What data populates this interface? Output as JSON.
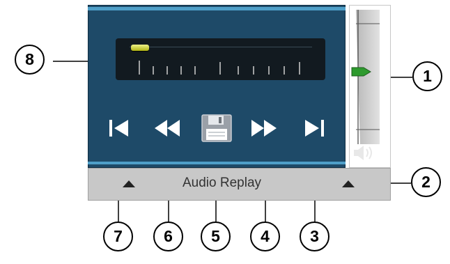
{
  "panel": {
    "title": "Audio Replay",
    "seek_position": 0.0,
    "volume_level": 0.55,
    "colors": {
      "panel_bg": "#1e4a68",
      "accent_line": "#4f9fc8",
      "thumb": "#d6db33",
      "volume_thumb": "#2e9a2e",
      "bar_bg": "#c8c8c8"
    }
  },
  "controls": [
    {
      "name": "skip-to-start-button",
      "icon": "skip-back-icon"
    },
    {
      "name": "rewind-button",
      "icon": "rewind-icon"
    },
    {
      "name": "save-button",
      "icon": "floppy-disk-icon"
    },
    {
      "name": "fast-forward-button",
      "icon": "fast-forward-icon"
    },
    {
      "name": "skip-to-end-button",
      "icon": "skip-forward-icon"
    }
  ],
  "callouts": {
    "c1": "1",
    "c2": "2",
    "c3": "3",
    "c4": "4",
    "c5": "5",
    "c6": "6",
    "c7": "7",
    "c8": "8"
  }
}
